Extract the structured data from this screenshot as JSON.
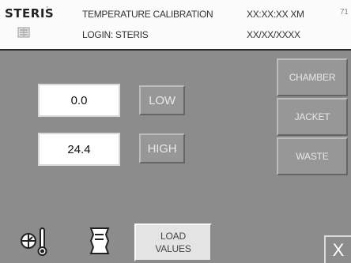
{
  "header": {
    "logo": "STERIS",
    "title": "TEMPERATURE CALIBRATION",
    "time": "XX:XX:XX XM",
    "corner": "71",
    "login": "LOGIN: STERIS",
    "date": "XX/XX/XXXX"
  },
  "calibration": {
    "low_value": "0.0",
    "high_value": "24.4",
    "low_label": "LOW",
    "high_label": "HIGH"
  },
  "sensors": {
    "chamber_label": "CHAMBER",
    "jacket_label": "JACKET",
    "waste_label": "WASTE"
  },
  "toolbar": {
    "load_values_line1": "LOAD",
    "load_values_line2": "VALUES",
    "close_label": "X"
  },
  "icons": [
    "steris-logo-icon",
    "thermometer-gauge-icon",
    "document-scroll-icon",
    "close-icon"
  ],
  "colors": {
    "background": "#8c8c8c",
    "button": "#979797",
    "header": "#fbfbfb"
  }
}
